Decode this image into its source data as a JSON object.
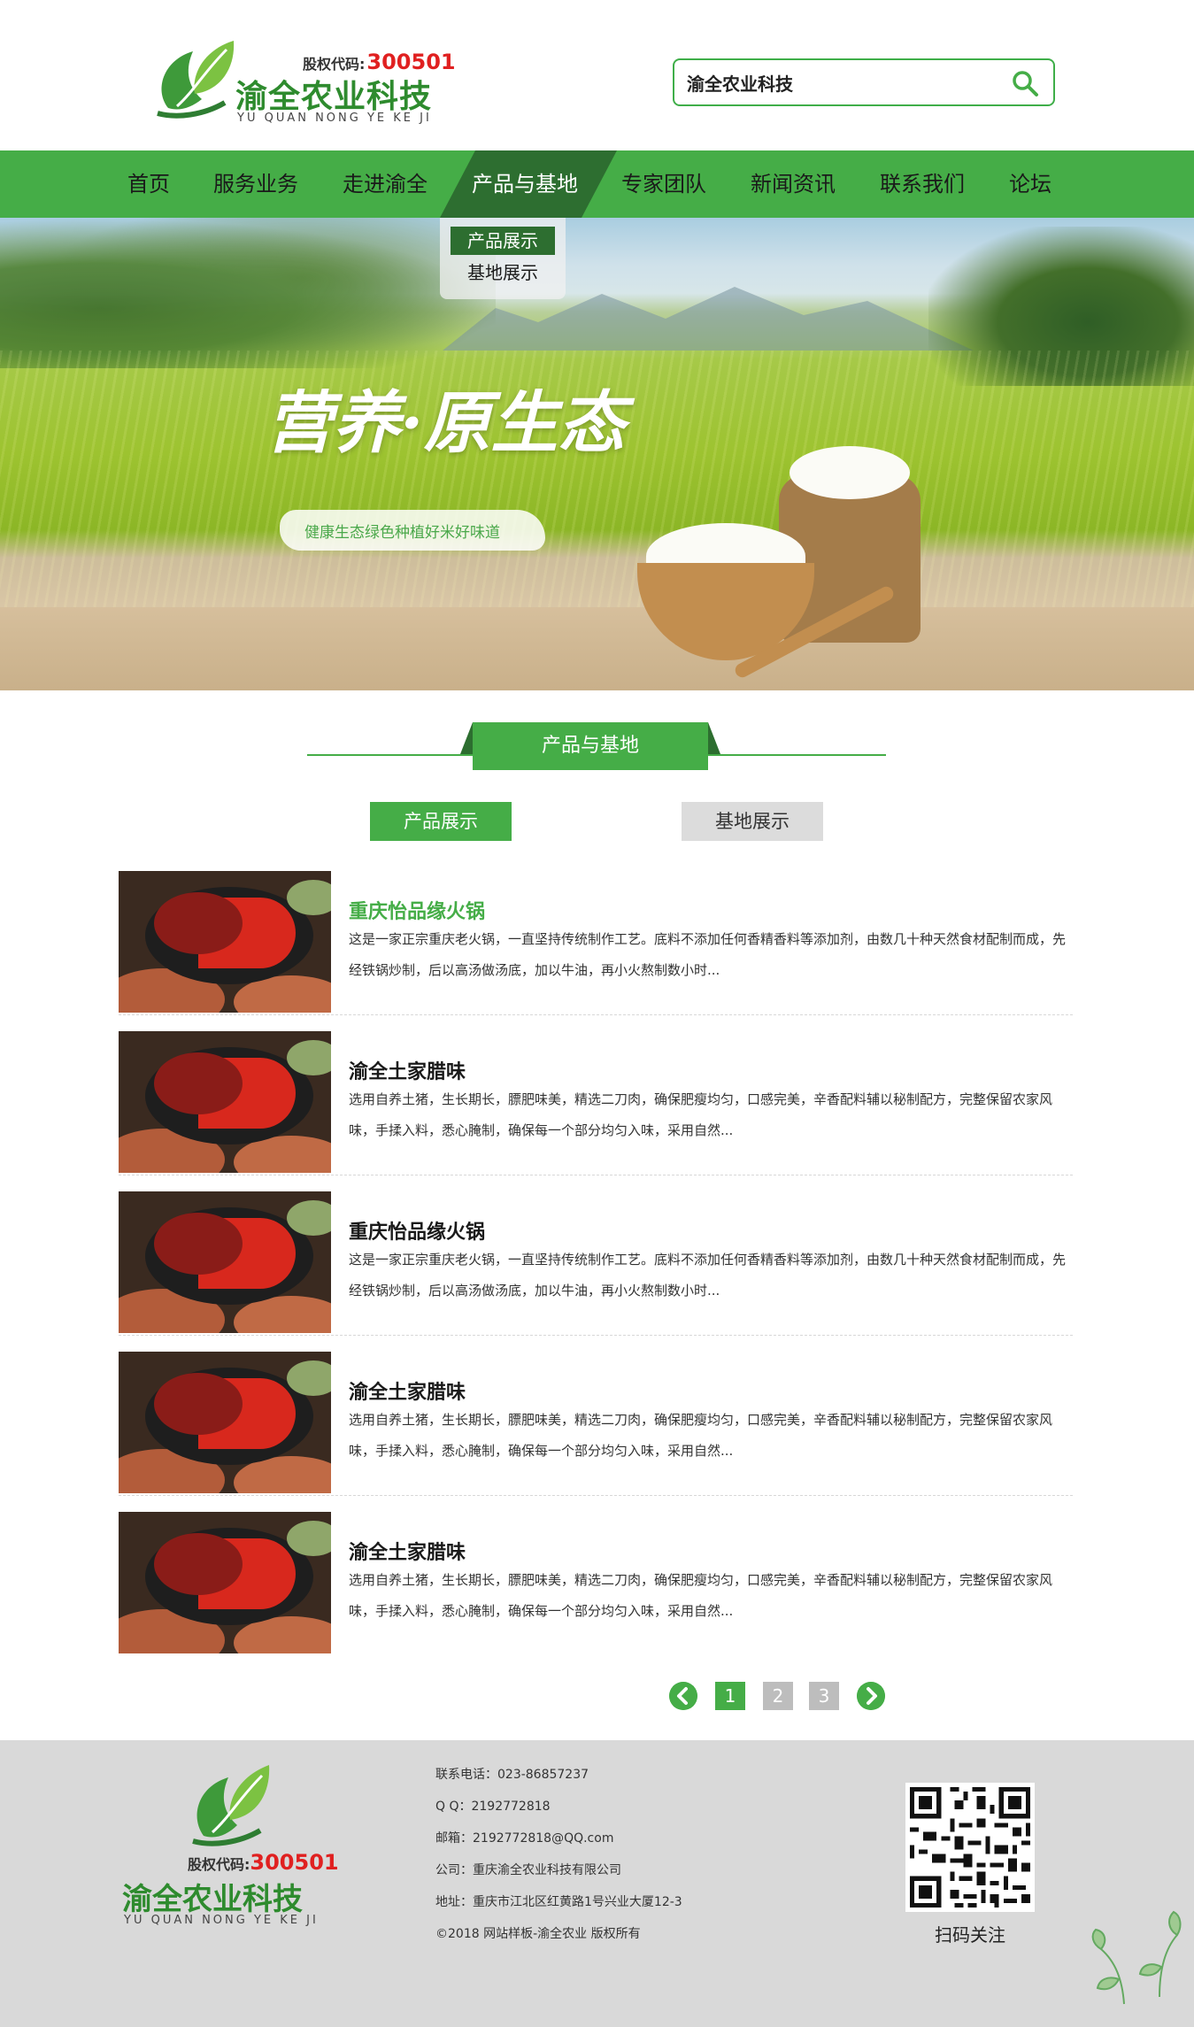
{
  "header": {
    "stock_label": "股权代码:",
    "stock_code": "300501",
    "brand_name": "渝全农业科技",
    "brand_en": "YU QUAN NONG YE KE JI",
    "search_value": "渝全农业科技"
  },
  "nav": {
    "items": [
      {
        "label": "首页"
      },
      {
        "label": "服务业务"
      },
      {
        "label": "走进渝全"
      },
      {
        "label": "产品与基地"
      },
      {
        "label": "专家团队"
      },
      {
        "label": "新闻资讯"
      },
      {
        "label": "联系我们"
      },
      {
        "label": "论坛"
      }
    ],
    "active_index": 3,
    "dropdown": [
      {
        "label": "产品展示"
      },
      {
        "label": "基地展示"
      }
    ]
  },
  "banner": {
    "slogan": "营养·原生态",
    "subline": "健康生态绿色种植好米好味道"
  },
  "section": {
    "title": "产品与基地",
    "tabs": [
      {
        "label": "产品展示",
        "active": true
      },
      {
        "label": "基地展示",
        "active": false
      }
    ]
  },
  "products": [
    {
      "title": "重庆怡品缘火锅",
      "desc": "这是一家正宗重庆老火锅，一直坚持传统制作工艺。底料不添加任何香精香料等添加剂，由数几十种天然食材配制而成，先经铁锅炒制，后以高汤做汤底，加以牛油，再小火熬制数小时..."
    },
    {
      "title": "渝全土家腊味",
      "desc": "选用自养土猪，生长期长，膘肥味美，精选二刀肉，确保肥瘦均匀，口感完美，辛香配料辅以秘制配方，完整保留农家风味，手揉入料，悉心腌制，确保每一个部分均匀入味，采用自然..."
    },
    {
      "title": "重庆怡品缘火锅",
      "desc": "这是一家正宗重庆老火锅，一直坚持传统制作工艺。底料不添加任何香精香料等添加剂，由数几十种天然食材配制而成，先经铁锅炒制，后以高汤做汤底，加以牛油，再小火熬制数小时..."
    },
    {
      "title": "渝全土家腊味",
      "desc": "选用自养土猪，生长期长，膘肥味美，精选二刀肉，确保肥瘦均匀，口感完美，辛香配料辅以秘制配方，完整保留农家风味，手揉入料，悉心腌制，确保每一个部分均匀入味，采用自然..."
    },
    {
      "title": "渝全土家腊味",
      "desc": "选用自养土猪，生长期长，膘肥味美，精选二刀肉，确保肥瘦均匀，口感完美，辛香配料辅以秘制配方，完整保留农家风味，手揉入料，悉心腌制，确保每一个部分均匀入味，采用自然..."
    }
  ],
  "pagination": {
    "pages": [
      "1",
      "2",
      "3"
    ],
    "current": "1"
  },
  "footer": {
    "stock_label": "股权代码:",
    "stock_code": "300501",
    "brand_name": "渝全农业科技",
    "brand_en": "YU QUAN NONG YE KE JI",
    "info": [
      "联系电话：023-86857237",
      "Q Q：2192772818",
      "邮箱：2192772818@QQ.com",
      "公司：重庆渝全农业科技有限公司",
      "地址：重庆市江北区红黄路1号兴业大厦12-3",
      "©2018 网站样板-渝全农业 版权所有"
    ],
    "qr_caption": "扫码关注"
  },
  "colors": {
    "brand_green": "#45ad47",
    "dark_green": "#2d6e30",
    "stock_red": "#e02020",
    "footer_bg": "#d9d9d9"
  }
}
